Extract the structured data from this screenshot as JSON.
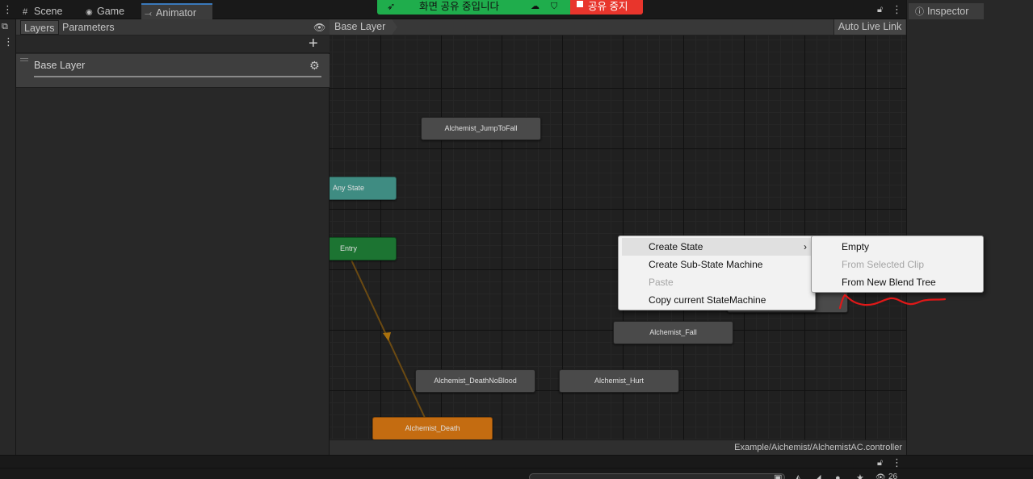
{
  "tabs": [
    {
      "label": "Scene",
      "icon": "grid-icon"
    },
    {
      "label": "Game",
      "icon": "gamepad-icon"
    },
    {
      "label": "Animator",
      "icon": "animator-icon"
    }
  ],
  "layers_panel": {
    "tabs": [
      "Layers",
      "Parameters"
    ],
    "layer_name": "Base Layer"
  },
  "graph": {
    "breadcrumb": "Base Layer",
    "auto_live_link": "Auto Live Link",
    "footer_path": "Example/Aichemist/AlchemistAC.controller",
    "nodes": {
      "jump_to_fall": "Alchemist_JumpToFall",
      "any_state": "Any State",
      "entry": "Entry",
      "fall": "Alchemist_Fall",
      "death_no_blood": "Alchemist_DeathNoBlood",
      "hurt": "Alchemist_Hurt",
      "death": "Alchemist_Death"
    }
  },
  "inspector": {
    "title": "Inspector"
  },
  "share": {
    "status": "화면 공유 중입니다",
    "stop": "공유 중지"
  },
  "context_menu": {
    "items": [
      "Create State",
      "Create Sub-State Machine",
      "Paste",
      "Copy current StateMachine"
    ],
    "submenu": [
      "Empty",
      "From Selected Clip",
      "From New Blend Tree"
    ]
  },
  "bottom": {
    "count": "26"
  },
  "colors": {
    "accent": "#3a79bb",
    "share_green": "#1fad4c",
    "stop_red": "#e8352c",
    "default_state": "#c46c11",
    "entry_state": "#1c7432",
    "any_state": "#3f8c82",
    "annotation": "#e01818"
  }
}
